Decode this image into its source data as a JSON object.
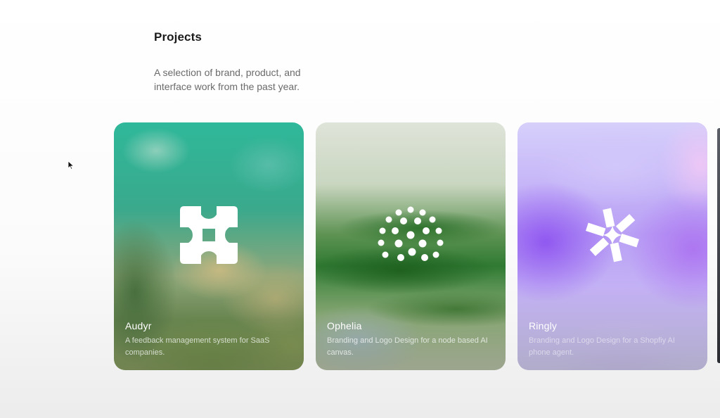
{
  "header": {
    "title": "Projects",
    "subtitle_line1": "A selection of brand, product, and",
    "subtitle_line2": "interface work from the past year."
  },
  "projects": [
    {
      "name": "Audyr",
      "description": "A feedback management system for SaaS companies.",
      "logo_icon": "puzzle-cross-icon",
      "accent": "#2fb89a"
    },
    {
      "name": "Ophelia",
      "description": "Branding and Logo Design for a node based AI canvas.",
      "logo_icon": "dot-arc-icon",
      "accent": "#2f7a33"
    },
    {
      "name": "Ringly",
      "description": "Branding and Logo Design for a Shopfiy AI phone agent.",
      "logo_icon": "asterisk-star-icon",
      "accent": "#9b6cf0"
    }
  ]
}
